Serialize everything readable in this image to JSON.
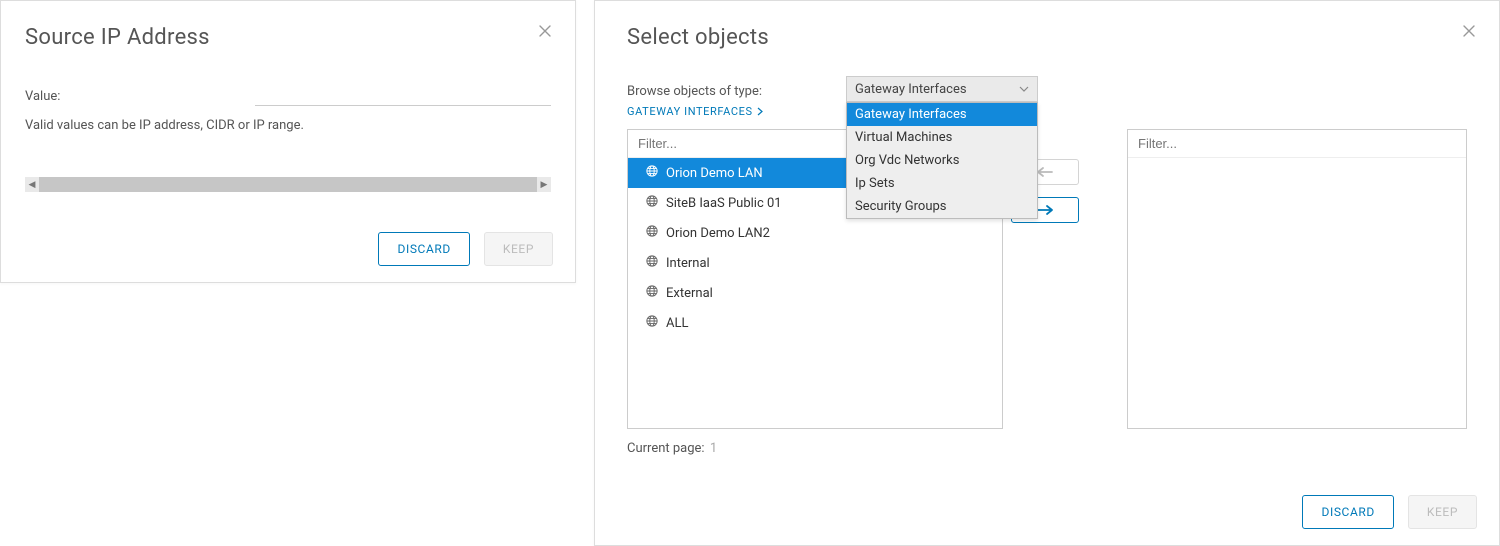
{
  "left": {
    "title": "Source IP Address",
    "value_label": "Value:",
    "value": "",
    "hint": "Valid values can be IP address, CIDR or IP range.",
    "discard": "DISCARD",
    "keep": "KEEP"
  },
  "right": {
    "title": "Select objects",
    "browse_label": "Browse objects of type:",
    "breadcrumb": "GATEWAY INTERFACES",
    "filter_placeholder_left": "Filter...",
    "filter_placeholder_right": "Filter...",
    "items": [
      "Orion Demo LAN",
      "SiteB IaaS Public 01",
      "Orion Demo LAN2",
      "Internal",
      "External",
      "ALL"
    ],
    "selected_index": 0,
    "dropdown": {
      "selected": "Gateway Interfaces",
      "options": [
        "Gateway Interfaces",
        "Virtual Machines",
        "Org Vdc Networks",
        "Ip Sets",
        "Security Groups"
      ],
      "selected_option_index": 0
    },
    "current_page_label": "Current page:",
    "current_page": "1",
    "discard": "DISCARD",
    "keep": "KEEP"
  }
}
